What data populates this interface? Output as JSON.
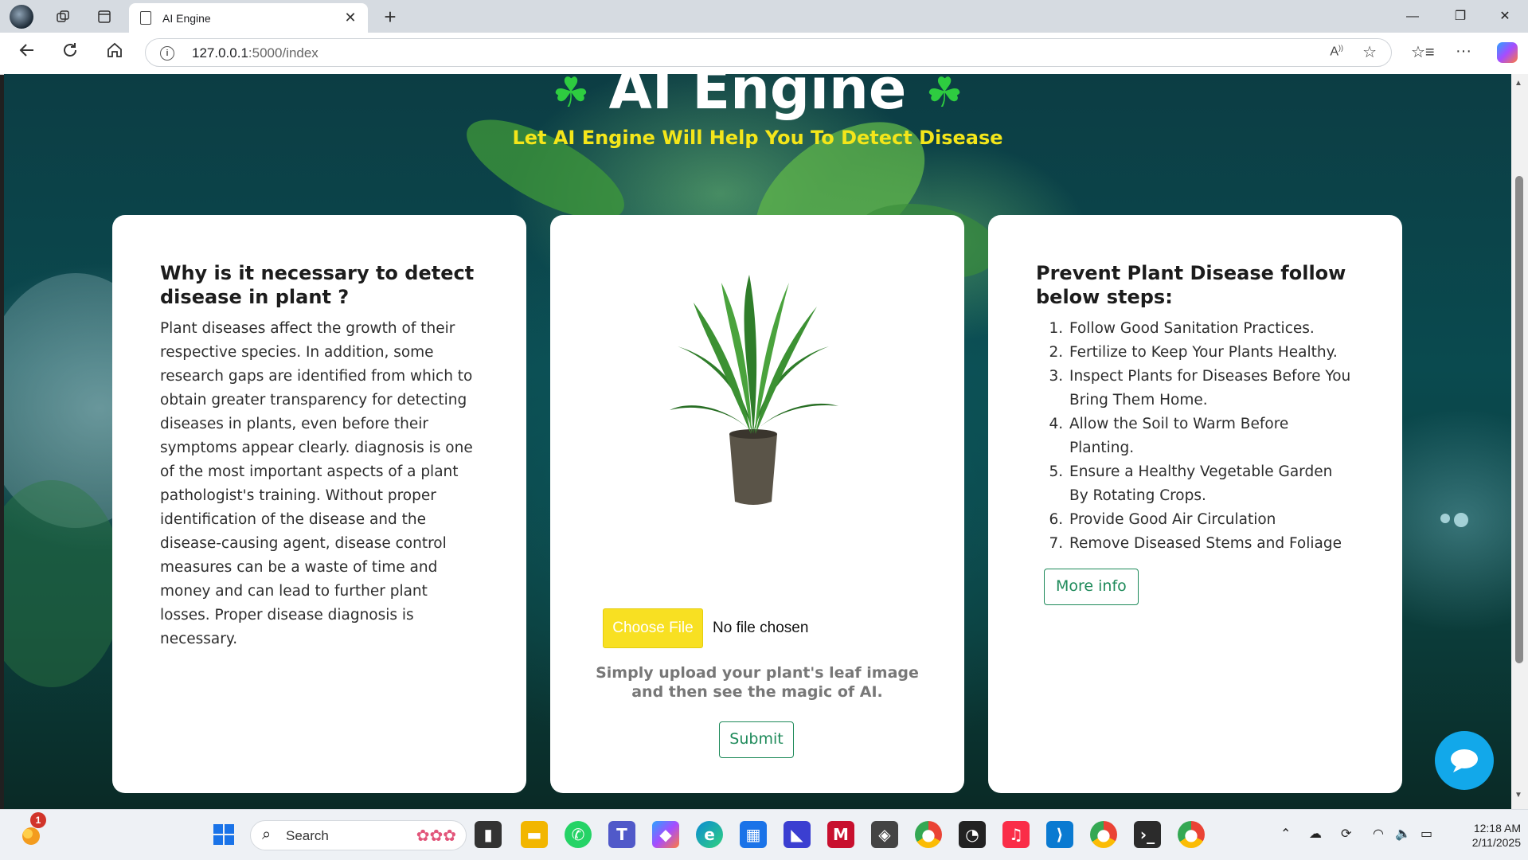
{
  "browser": {
    "tab_title": "AI Engine",
    "close_tab_glyph": "✕",
    "new_tab_glyph": "+",
    "url_host": "127.0.0.1",
    "url_rest": ":5000/index",
    "window_controls": {
      "minimize": "—",
      "restore": "❐",
      "close": "✕"
    }
  },
  "hero": {
    "title": "AI Engine",
    "clover_glyph": "☘",
    "subtitle": "Let AI Engine Will Help You To Detect Disease"
  },
  "left_card": {
    "heading": "Why is it necessary to detect disease in plant ?",
    "body": "Plant diseases affect the growth of their respective species. In addition, some research gaps are identified from which to obtain greater transparency for detecting diseases in plants, even before their symptoms appear clearly. diagnosis is one of the most important aspects of a plant pathologist's training. Without proper identification of the disease and the disease-causing agent, disease control measures can be a waste of time and money and can lead to further plant losses. Proper disease diagnosis is necessary."
  },
  "upload_card": {
    "choose_file_label": "Choose File",
    "no_file_label": "No file chosen",
    "hint": "Simply upload your plant's leaf image and then see the magic of AI.",
    "submit_label": "Submit"
  },
  "right_card": {
    "heading": "Prevent Plant Disease follow below steps:",
    "steps": [
      "Follow Good Sanitation Practices.",
      "Fertilize to Keep Your Plants Healthy.",
      "Inspect Plants for Diseases Before You Bring Them Home.",
      "Allow the Soil to Warm Before Planting.",
      "Ensure a Healthy Vegetable Garden By Rotating Crops.",
      "Provide Good Air Circulation",
      "Remove Diseased Stems and Foliage"
    ],
    "more_info_label": "More info"
  },
  "taskbar": {
    "search_label": "Search",
    "notification_count": "1",
    "time": "12:18 AM",
    "date": "2/11/2025"
  },
  "colors": {
    "accent_yellow": "#f8e022",
    "accent_green": "#1e8a5a",
    "chat_blue": "#12a8ea"
  }
}
